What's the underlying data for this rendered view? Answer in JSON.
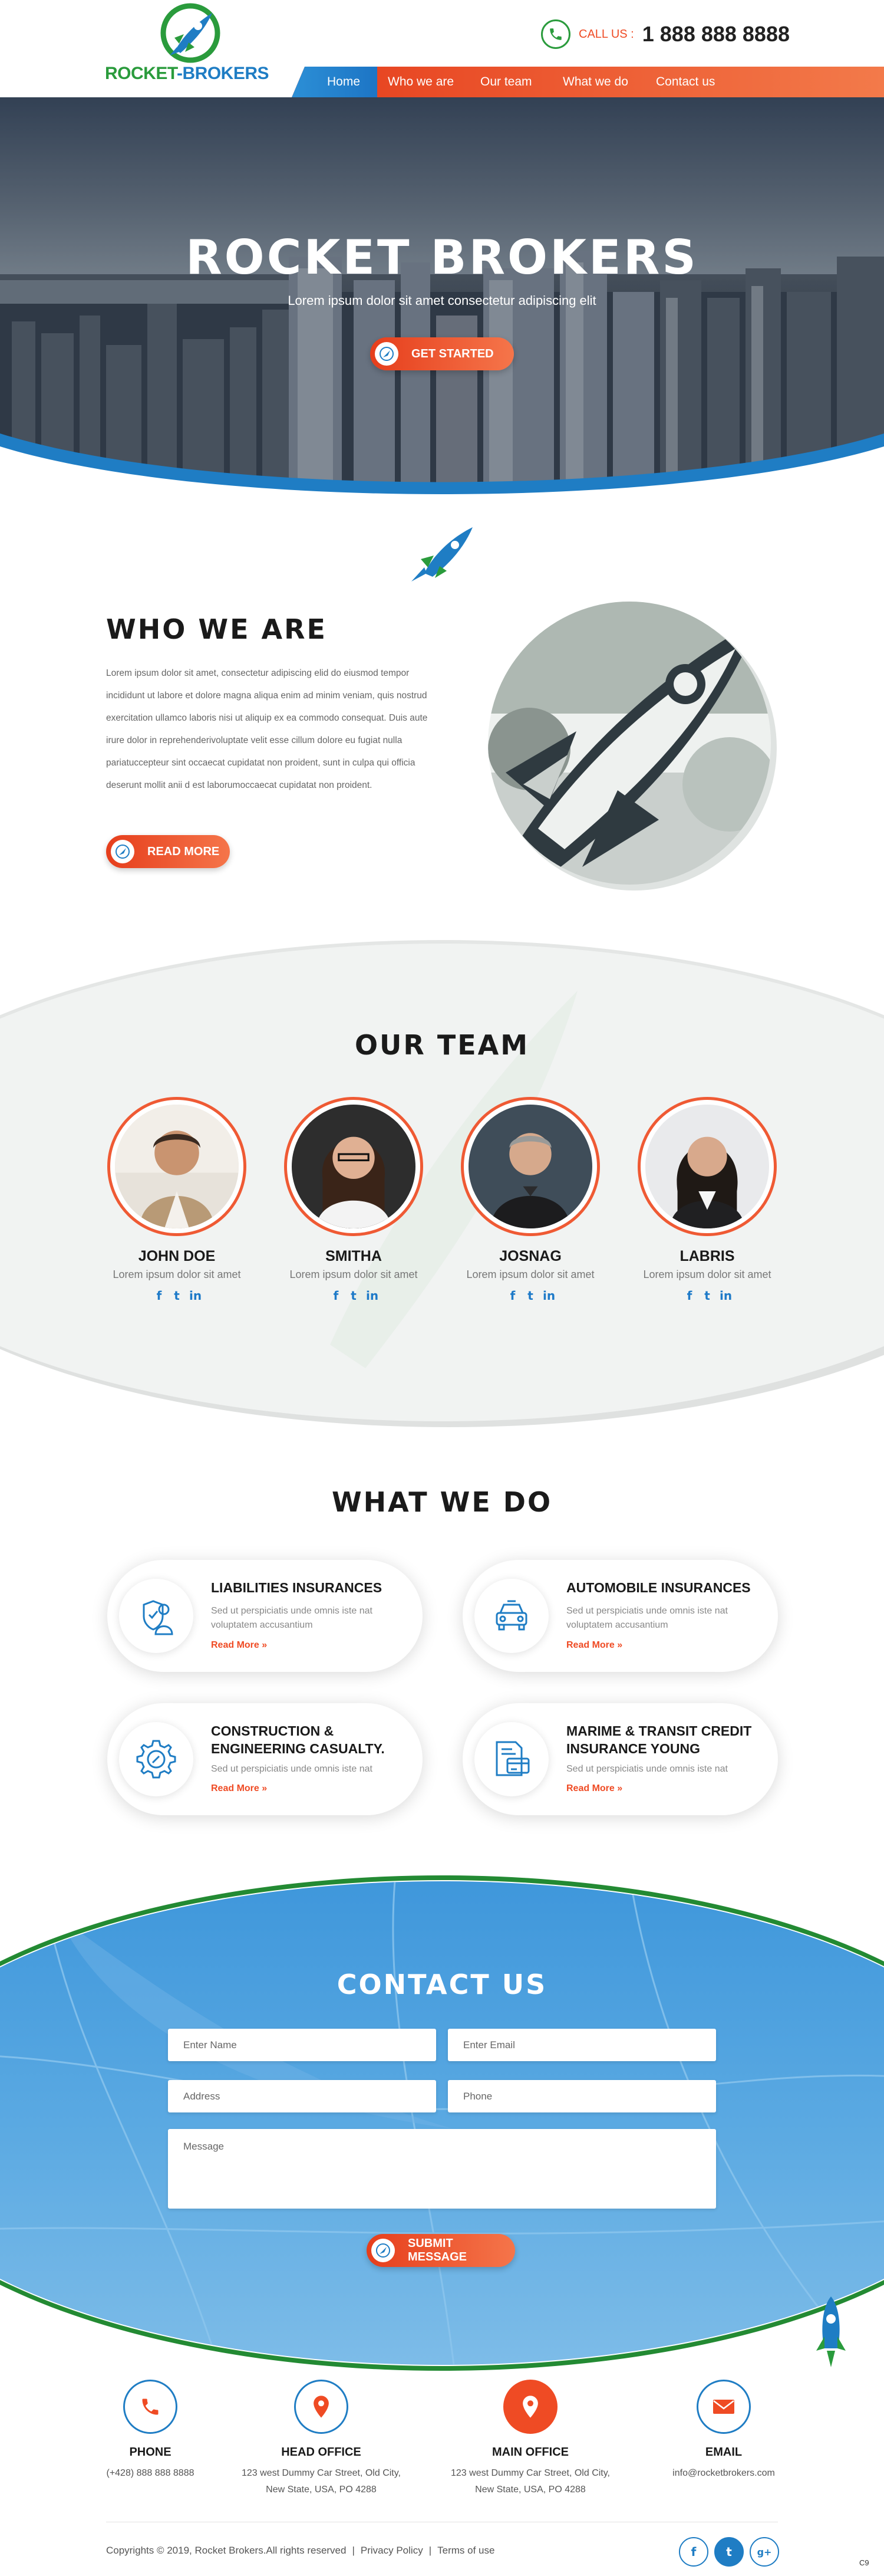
{
  "header": {
    "brand_part1": "ROCKET",
    "brand_part2": "-BROKERS",
    "call_label": "CALL US :",
    "phone": "1 888 888 8888",
    "nav": [
      "Home",
      "Who we are",
      "Our team",
      "What we do",
      "Contact us"
    ]
  },
  "hero": {
    "title": "ROCKET BROKERS",
    "subtitle": "Lorem ipsum dolor sit amet consectetur adipiscing elit",
    "button": "GET STARTED",
    "slides": 5,
    "active_slide": 3
  },
  "who": {
    "title": "WHO WE ARE",
    "text": "Lorem ipsum dolor sit amet, consectetur adipiscing elid do eiusmod tempor incididunt ut labore et dolore magna aliqua enim ad minim veniam, quis nostrud exercitation ullamco laboris nisi ut aliquip ex ea commodo consequat. Duis aute irure dolor in reprehenderivoluptate velit esse cillum dolore eu fugiat nulla pariatuccepteur sint occaecat cupidatat non proident, sunt in culpa qui officia deserunt mollit anii d est laborumoccaecat cupidatat non proident.",
    "button": "READ MORE"
  },
  "team": {
    "title": "OUR TEAM",
    "members": [
      {
        "name": "JOHN DOE",
        "role": "Lorem ipsum dolor sit amet"
      },
      {
        "name": "SMITHA",
        "role": "Lorem ipsum dolor sit amet"
      },
      {
        "name": "JOSNAG",
        "role": "Lorem ipsum dolor sit amet"
      },
      {
        "name": "LABRIS",
        "role": "Lorem ipsum dolor sit amet"
      }
    ]
  },
  "services": {
    "title": "WHAT WE DO",
    "items": [
      {
        "title": "LIABILITIES INSURANCES",
        "text": "Sed ut perspiciatis unde omnis iste nat voluptatem accusantium",
        "more": "Read More »",
        "icon": "shield-person-icon"
      },
      {
        "title": "AUTOMOBILE INSURANCES",
        "text": "Sed ut perspiciatis unde omnis iste nat voluptatem accusantium",
        "more": "Read More »",
        "icon": "car-icon"
      },
      {
        "title": "CONSTRUCTION & ENGINEERING CASUALTY.",
        "text": "Sed ut perspiciatis unde omnis iste nat",
        "more": "Read More »",
        "icon": "gear-wrench-icon"
      },
      {
        "title": "MARIME & TRANSIT CREDIT INSURANCE YOUNG",
        "text": "Sed ut perspiciatis unde omnis iste nat",
        "more": "Read More »",
        "icon": "document-card-icon"
      }
    ]
  },
  "contact": {
    "title": "CONTACT US",
    "name_placeholder": "Enter Name",
    "email_placeholder": "Enter Email",
    "address_placeholder": "Address",
    "phone_placeholder": "Phone",
    "message_placeholder": "Message",
    "button": "SUBMIT MESSAGE"
  },
  "info": [
    {
      "title": "PHONE",
      "lines": [
        "(+428) 888 888 8888"
      ]
    },
    {
      "title": "HEAD OFFICE",
      "lines": [
        "123 west Dummy Car Street, Old City,",
        "New State, USA, PO 4288"
      ]
    },
    {
      "title": "MAIN OFFICE",
      "lines": [
        "123 west Dummy Car Street, Old City,",
        "New State, USA, PO 4288"
      ]
    },
    {
      "title": "EMAIL",
      "lines": [
        "info@rocketbrokers.com"
      ]
    }
  ],
  "footer": {
    "copyright": "Copyrights © 2019, Rocket Brokers.All rights reserved",
    "privacy": "Privacy Policy",
    "terms": "Terms of use",
    "corner": "C9"
  },
  "colors": {
    "orange": "#ef4b24",
    "blue": "#1f7dc4",
    "green": "#2a9b3c"
  }
}
